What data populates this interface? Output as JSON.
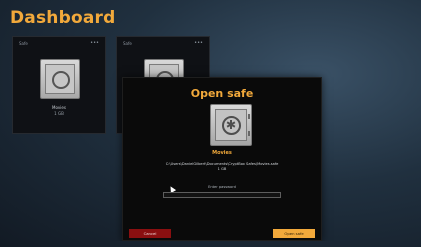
{
  "header": {
    "title": "Dashboard"
  },
  "cards": [
    {
      "header": "Safe",
      "name": "Movies",
      "size": "1 GB"
    },
    {
      "header": "Safe"
    }
  ],
  "dialog": {
    "title": "Open safe",
    "safe_name": "Movies",
    "path": "C:\\Users\\DanielGilbert\\Documents\\CryptBox Safes\\Movies.safe",
    "size": "1 GB",
    "password_label": "Enter password",
    "password_value": "",
    "cancel_label": "Cancel",
    "open_label": "Open safe"
  },
  "colors": {
    "accent": "#f2a93b",
    "cancel": "#8a0f10",
    "dialog_bg": "#0a0a0a"
  },
  "icons": [
    "safe-icon",
    "menu-icon",
    "cursor-icon"
  ]
}
